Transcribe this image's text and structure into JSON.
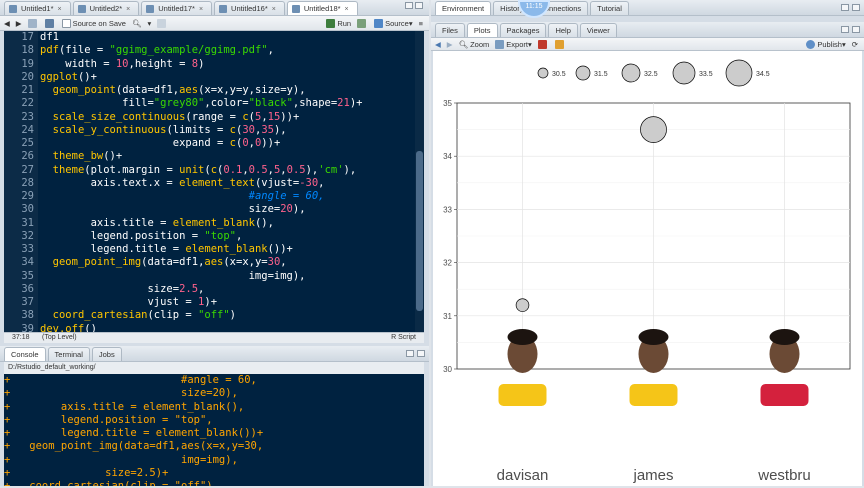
{
  "editor_tabs": [
    {
      "label": "Untitled1*"
    },
    {
      "label": "Untitled2*"
    },
    {
      "label": "Untitled17*"
    },
    {
      "label": "Untitled16*"
    },
    {
      "label": "Untitled18*"
    }
  ],
  "editor_toolbar": {
    "source_on_save": "Source on Save",
    "run": "Run",
    "source": "Source"
  },
  "code_lines": [
    {
      "n": "17",
      "html": "df1"
    },
    {
      "n": "18",
      "html": "<span class=fn>pdf</span>(file = <span class=str>\"ggimg_example/ggimg.pdf\"</span>,"
    },
    {
      "n": "19",
      "html": "    width = <span class=num>10</span>,height = <span class=num>8</span>)"
    },
    {
      "n": "20",
      "html": "<span class=fn>ggplot</span>()+"
    },
    {
      "n": "21",
      "html": "  <span class=fn>geom_point</span>(data=df1,<span class=fn>aes</span>(x=x,y=y,size=y),"
    },
    {
      "n": "22",
      "html": "             fill=<span class=str>\"grey80\"</span>,color=<span class=str>\"black\"</span>,shape=<span class=num>21</span>)+"
    },
    {
      "n": "23",
      "html": "  <span class=fn>scale_size_continuous</span>(range = <span class=fn>c</span>(<span class=num>5</span>,<span class=num>15</span>))+"
    },
    {
      "n": "24",
      "html": "  <span class=fn>scale_y_continuous</span>(limits = <span class=fn>c</span>(<span class=num>30</span>,<span class=num>35</span>),"
    },
    {
      "n": "25",
      "html": "                     expand = <span class=fn>c</span>(<span class=num>0</span>,<span class=num>0</span>))+"
    },
    {
      "n": "26",
      "html": "  <span class=fn>theme_bw</span>()+"
    },
    {
      "n": "27",
      "html": "  <span class=fn>theme</span>(plot.margin = <span class=fn>unit</span>(<span class=fn>c</span>(<span class=num>0.1</span>,<span class=num>0.5</span>,<span class=num>5</span>,<span class=num>0.5</span>),<span class=str>'cm'</span>),"
    },
    {
      "n": "28",
      "html": "        axis.text.x = <span class=fn>element_text</span>(vjust=<span class=num>-30</span>,"
    },
    {
      "n": "29",
      "html": "                                 <span class=cm>#angle = 60,</span>"
    },
    {
      "n": "30",
      "html": "                                 size=<span class=num>20</span>),"
    },
    {
      "n": "31",
      "html": "        axis.title = <span class=fn>element_blank</span>(),"
    },
    {
      "n": "32",
      "html": "        legend.position = <span class=str>\"top\"</span>,"
    },
    {
      "n": "33",
      "html": "        legend.title = <span class=fn>element_blank</span>())+"
    },
    {
      "n": "34",
      "html": "  <span class=fn>geom_point_img</span>(data=df1,<span class=fn>aes</span>(x=x,y=<span class=num>30</span>,"
    },
    {
      "n": "35",
      "html": "                                 img=img),"
    },
    {
      "n": "36",
      "html": "                 size=<span class=num>2.5</span>,"
    },
    {
      "n": "37",
      "html": "                 vjust = <span class=num>1</span>)+"
    },
    {
      "n": "38",
      "html": "  <span class=fn>coord_cartesian</span>(clip = <span class=str>\"off\"</span>)"
    },
    {
      "n": "39",
      "html": "<span class=fn>dev.off</span>()"
    }
  ],
  "editor_status": {
    "position": "37:18",
    "scope": "(Top Level)",
    "filetype": "R Script"
  },
  "console_tabs": [
    {
      "label": "Console"
    },
    {
      "label": "Terminal"
    },
    {
      "label": "Jobs"
    }
  ],
  "console_path": "D:/Rstudio_default_working/",
  "console_lines": [
    "+                           #angle = 60,",
    "+                           size=20),",
    "+        axis.title = element_blank(),",
    "+        legend.position = \"top\",",
    "+        legend.title = element_blank())+",
    "+   geom_point_img(data=df1,aes(x=x,y=30,",
    "+                           img=img),",
    "+               size=2.5)+",
    "+   coord_cartesian(clip = \"off\")"
  ],
  "env_tabs": [
    {
      "label": "Environment"
    },
    {
      "label": "History"
    },
    {
      "label": "Connections"
    },
    {
      "label": "Tutorial"
    }
  ],
  "clock": "11:15",
  "files_tabs": [
    {
      "label": "Files"
    },
    {
      "label": "Plots"
    },
    {
      "label": "Packages"
    },
    {
      "label": "Help"
    },
    {
      "label": "Viewer"
    }
  ],
  "plots_toolbar": {
    "zoom": "Zoom",
    "export": "Export",
    "publish": "Publish"
  },
  "chart_data": {
    "type": "scatter",
    "title": "",
    "xlabel": "",
    "ylabel": "",
    "categories": [
      "davisan",
      "james",
      "westbru"
    ],
    "y": [
      31.2,
      34.5,
      null
    ],
    "ylim": [
      30,
      35
    ],
    "yticks": [
      "30",
      "31",
      "32",
      "33",
      "34",
      "35"
    ],
    "size_legend": [
      "30.5",
      "31.5",
      "32.5",
      "33.5",
      "34.5"
    ],
    "grid": true,
    "legend": "top",
    "point_fill": "#cccccc",
    "point_stroke": "#000000"
  }
}
